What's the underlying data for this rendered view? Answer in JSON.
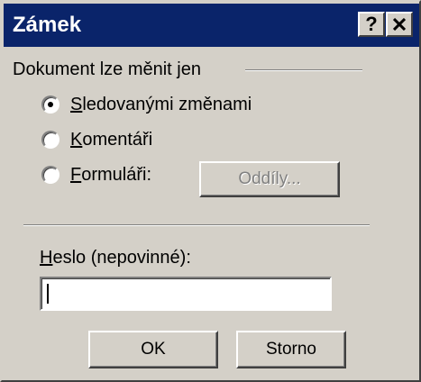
{
  "window": {
    "title": "Zámek",
    "help_label": "?",
    "titlebar_color": "#0a246a",
    "face_color": "#d4d0c8"
  },
  "protect": {
    "group_label": "Dokument lze měnit jen",
    "options": [
      {
        "accel": "S",
        "rest": "ledovanými změnami",
        "checked": true
      },
      {
        "accel": "K",
        "rest": "omentáři",
        "checked": false
      },
      {
        "accel": "F",
        "rest": "ormuláři:",
        "checked": false
      }
    ],
    "sections_button": "Oddíly..."
  },
  "password": {
    "label_accel": "H",
    "label_rest": "eslo (nepovinné):",
    "value": ""
  },
  "buttons": {
    "ok": "OK",
    "cancel": "Storno"
  }
}
